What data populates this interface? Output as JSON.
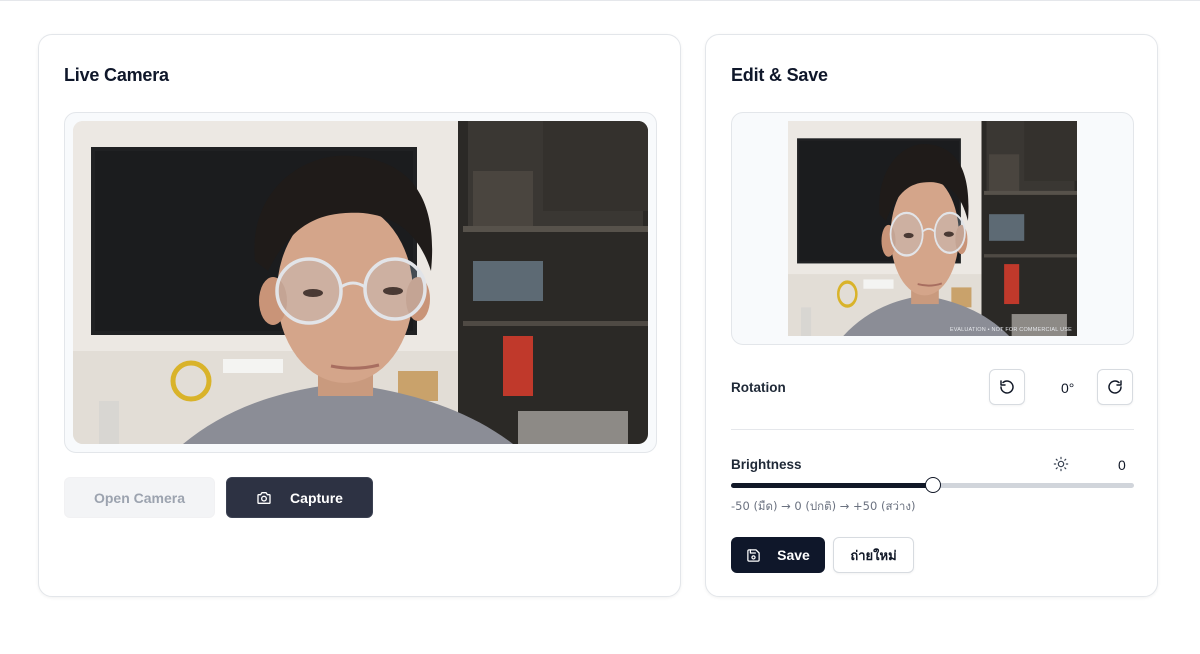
{
  "live_camera": {
    "title": "Live Camera",
    "open_camera_label": "Open Camera",
    "capture_label": "Capture"
  },
  "edit_save": {
    "title": "Edit & Save",
    "watermark": "EVALUATION • NOT FOR COMMERCIAL USE",
    "rotation": {
      "label": "Rotation",
      "value": "0°"
    },
    "brightness": {
      "label": "Brightness",
      "value": "0",
      "level": 0,
      "min": -50,
      "max": 50,
      "hint": "-50 (มืด) → 0 (ปกติ) → +50 (สว่าง)"
    },
    "save_label": "Save",
    "retake_label": "ถ่ายใหม่"
  },
  "icons": {
    "capture": "camera-icon",
    "rotate_left": "rotate-ccw-icon",
    "rotate_right": "rotate-cw-icon",
    "brightness": "sun-icon",
    "save": "save-icon"
  },
  "colors": {
    "primary_dark": "#0f172a",
    "capture_button": "#2d3243",
    "disabled_button": "#f3f4f6",
    "border": "#e3e6ea"
  }
}
